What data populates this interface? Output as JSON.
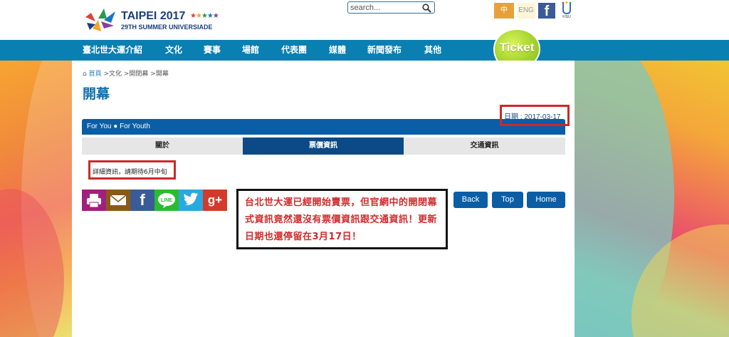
{
  "header": {
    "logo_title": "TAIPEI 2017",
    "logo_subtitle": "29TH SUMMER UNIVERSIADE",
    "search_placeholder": "search...",
    "lang_zh": "中",
    "lang_en": "ENG",
    "facebook_glyph": "f",
    "fisu_label": "FISU"
  },
  "nav": {
    "items": [
      "臺北世大運介紹",
      "文化",
      "賽事",
      "場館",
      "代表團",
      "媒體",
      "新聞發布",
      "其他"
    ],
    "ticket_label": "Ticket"
  },
  "content": {
    "breadcrumb_home": "首頁",
    "breadcrumb_rest": ">文化 >開閉幕 >開幕",
    "page_title": "開幕",
    "date_text": "日期 : 2017-03-17",
    "tagline": "For You ● For Youth",
    "tabs": [
      "關於",
      "票價資訊",
      "交通資訊"
    ],
    "info_text": "詳細資訊，請期待6月中旬",
    "callout": "台北世大運已經開始賣票，但官網中的開閉幕式資訊竟然還沒有票價資訊跟交通資訊！更新日期也還停留在3月17日！",
    "buttons": {
      "back": "Back",
      "top": "Top",
      "home": "Home"
    }
  },
  "social": [
    {
      "name": "print-icon",
      "color": "#a0207e"
    },
    {
      "name": "email-icon",
      "color": "#8a5a14"
    },
    {
      "name": "facebook-icon",
      "color": "#3b5a98"
    },
    {
      "name": "line-icon",
      "color": "#2bbb30"
    },
    {
      "name": "twitter-icon",
      "color": "#2aa9e0"
    },
    {
      "name": "google-plus-icon",
      "color": "#d23a2b"
    }
  ],
  "colors": {
    "nav_blue": "#0a7fb2",
    "tagline_blue": "#0a5ea5",
    "active_tab": "#0b4a86",
    "highlight_red": "#cc2a2a",
    "ticket_green": "#9ad020"
  }
}
